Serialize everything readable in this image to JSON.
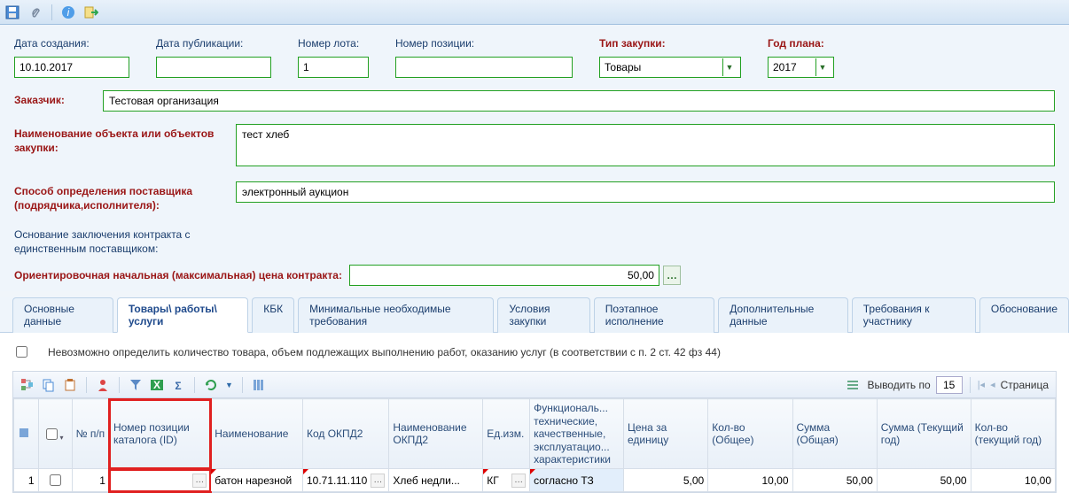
{
  "toolbar": {
    "save": "save",
    "attach": "attach",
    "info": "info",
    "exit": "exit"
  },
  "labels": {
    "createDate": "Дата создания:",
    "pubDate": "Дата публикации:",
    "lotNum": "Номер лота:",
    "posNum": "Номер позиции:",
    "purchType": "Тип закупки:",
    "planYear": "Год плана:",
    "customer": "Заказчик:",
    "objName": "Наименование объекта или объектов закупки:",
    "method": "Способ определения поставщика (подрядчика,исполнителя):",
    "basis": "Основание заключения контракта с единственным поставщиком:",
    "price": "Ориентировочная начальная (максимальная) цена контракта:"
  },
  "values": {
    "createDate": "10.10.2017",
    "pubDate": "",
    "lotNum": "1",
    "posNum": "",
    "purchType": "Товары",
    "planYear": "2017",
    "customer": "Тестовая организация",
    "objName": "тест хлеб",
    "method": "электронный аукцион",
    "basis": "",
    "price": "50,00"
  },
  "tabs": [
    "Основные данные",
    "Товары\\ работы\\ услуги",
    "КБК",
    "Минимальные необходимые требования",
    "Условия закупки",
    "Поэтапное исполнение",
    "Дополнительные данные",
    "Требования к участнику",
    "Обоснование"
  ],
  "activeTab": 1,
  "pane": {
    "chkText": "Невозможно определить количество товара, объем подлежащих выполнению работ, оказанию услуг (в соответствии с п. 2 ст. 42 фз 44)"
  },
  "gridToolbar": {
    "perPageLabel": "Выводить по",
    "perPage": "15",
    "pageLabel": "Страница"
  },
  "grid": {
    "headers": {
      "num": "№ п/п",
      "catalogId": "Номер позиции каталога (ID)",
      "name": "Наименование",
      "okpd2": "Код ОКПД2",
      "okpd2name": "Наименование ОКПД2",
      "uom": "Ед.изм.",
      "funcChar": "Функциональ... технические, качественные, эксплуатацио... характеристики",
      "unitPrice": "Цена за единицу",
      "qtyTotal": "Кол-во (Общее)",
      "sumTotal": "Сумма (Общая)",
      "sumYear": "Сумма (Текущий год)",
      "qtyYear": "Кол-во (текущий год)"
    },
    "row": {
      "idx": "1",
      "num": "1",
      "catalogId": "",
      "name": "батон нарезной",
      "okpd2": "10.71.11.110",
      "okpd2name": "Хлеб недли...",
      "uom": "КГ",
      "funcChar": "согласно ТЗ",
      "unitPrice": "5,00",
      "qtyTotal": "10,00",
      "sumTotal": "50,00",
      "sumYear": "50,00",
      "qtyYear": "10,00"
    }
  }
}
